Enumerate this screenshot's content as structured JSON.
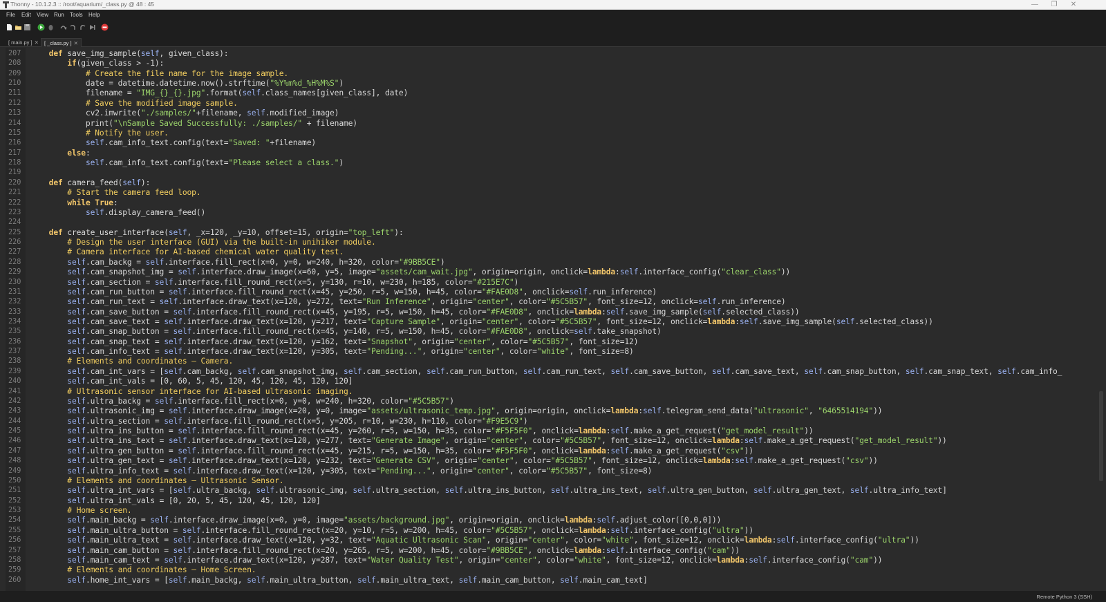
{
  "window": {
    "title": "Thonny  -  10.1.2.3 :: /root/aquarium/_class.py  @  48 : 45",
    "controls": {
      "minimize": "—",
      "maximize": "❐",
      "close": "✕"
    }
  },
  "menubar": {
    "items": [
      "File",
      "Edit",
      "View",
      "Run",
      "Tools",
      "Help"
    ]
  },
  "toolbar": {
    "buttons": [
      "new-file-icon",
      "open-folder-icon",
      "save-icon",
      "run-icon",
      "debug-icon",
      "step-over-icon",
      "step-into-icon",
      "step-out-icon",
      "resume-icon",
      "stop-icon"
    ]
  },
  "tabs": [
    {
      "label": "[ main.py ]",
      "close": "✕",
      "active": false
    },
    {
      "label": "[ _class.py ]",
      "close": "✕",
      "active": true
    }
  ],
  "editor": {
    "line_numbers": [
      "207",
      "208",
      "209",
      "210",
      "211",
      "212",
      "213",
      "214",
      "215",
      "216",
      "217",
      "218",
      "219",
      "220",
      "221",
      "222",
      "223",
      "224",
      "225",
      "226",
      "227",
      "228",
      "229",
      "230",
      "231",
      "232",
      "233",
      "234",
      "235",
      "236",
      "237",
      "238",
      "239",
      "240",
      "241",
      "242",
      "243",
      "244",
      "245",
      "246",
      "247",
      "248",
      "249",
      "250",
      "251",
      "252",
      "253",
      "254",
      "255",
      "256",
      "257",
      "258",
      "259",
      "260"
    ],
    "lines": [
      "    def save_img_sample(self, given_class):",
      "        if(given_class > -1):",
      "            # Create the file name for the image sample.",
      "            date = datetime.datetime.now().strftime(\"%Y%m%d_%H%M%S\")",
      "            filename = \"IMG_{}_{}.jpg\".format(self.class_names[given_class], date)",
      "            # Save the modified image sample.",
      "            cv2.imwrite(\"./samples/\"+filename, self.modified_image)",
      "            print(\"\\nSample Saved Successfully: ./samples/\" + filename)",
      "            # Notify the user.",
      "            self.cam_info_text.config(text=\"Saved: \"+filename)",
      "        else:",
      "            self.cam_info_text.config(text=\"Please select a class.\")",
      "",
      "    def camera_feed(self):",
      "        # Start the camera feed loop.",
      "        while True:",
      "            self.display_camera_feed()",
      "",
      "    def create_user_interface(self, _x=120, _y=10, offset=15, origin=\"top_left\"):",
      "        # Design the user interface (GUI) via the built-in unihiker module.",
      "        # Camera interface for AI-based chemical water quality test.",
      "        self.cam_backg = self.interface.fill_rect(x=0, y=0, w=240, h=320, color=\"#9BB5CE\")",
      "        self.cam_snapshot_img = self.interface.draw_image(x=60, y=5, image=\"assets/cam_wait.jpg\", origin=origin, onclick=lambda:self.interface_config(\"clear_class\"))",
      "        self.cam_section = self.interface.fill_round_rect(x=5, y=130, r=10, w=230, h=185, color=\"#215E7C\")",
      "        self.cam_run_button = self.interface.fill_round_rect(x=45, y=250, r=5, w=150, h=45, color=\"#FAE0D8\", onclick=self.run_inference)",
      "        self.cam_run_text = self.interface.draw_text(x=120, y=272, text=\"Run Inference\", origin=\"center\", color=\"#5C5B57\", font_size=12, onclick=self.run_inference)",
      "        self.cam_save_button = self.interface.fill_round_rect(x=45, y=195, r=5, w=150, h=45, color=\"#FAE0D8\", onclick=lambda:self.save_img_sample(self.selected_class))",
      "        self.cam_save_text = self.interface.draw_text(x=120, y=217, text=\"Capture Sample\", origin=\"center\", color=\"#5C5B57\", font_size=12, onclick=lambda:self.save_img_sample(self.selected_class))",
      "        self.cam_snap_button = self.interface.fill_round_rect(x=45, y=140, r=5, w=150, h=45, color=\"#FAE0D8\", onclick=self.take_snapshot)",
      "        self.cam_snap_text = self.interface.draw_text(x=120, y=162, text=\"Snapshot\", origin=\"center\", color=\"#5C5B57\", font_size=12)",
      "        self.cam_info_text = self.interface.draw_text(x=120, y=305, text=\"Pending...\", origin=\"center\", color=\"white\", font_size=8)",
      "        # Elements and coordinates — Camera.",
      "        self.cam_int_vars = [self.cam_backg, self.cam_snapshot_img, self.cam_section, self.cam_run_button, self.cam_run_text, self.cam_save_button, self.cam_save_text, self.cam_snap_button, self.cam_snap_text, self.cam_info_",
      "        self.cam_int_vals = [0, 60, 5, 45, 120, 45, 120, 45, 120, 120]",
      "        # Ultrasonic sensor interface for AI-based ultrasonic imaging.",
      "        self.ultra_backg = self.interface.fill_rect(x=0, y=0, w=240, h=320, color=\"#5C5B57\")",
      "        self.ultrasonic_img = self.interface.draw_image(x=20, y=0, image=\"assets/ultrasonic_temp.jpg\", origin=origin, onclick=lambda:self.telegram_send_data(\"ultrasonic\", \"6465514194\"))",
      "        self.ultra_section = self.interface.fill_round_rect(x=5, y=205, r=10, w=230, h=110, color=\"#F9E5C9\")",
      "        self.ultra_ins_button = self.interface.fill_round_rect(x=45, y=260, r=5, w=150, h=35, color=\"#F5F5F0\", onclick=lambda:self.make_a_get_request(\"get_model_result\"))",
      "        self.ultra_ins_text = self.interface.draw_text(x=120, y=277, text=\"Generate Image\", origin=\"center\", color=\"#5C5B57\", font_size=12, onclick=lambda:self.make_a_get_request(\"get_model_result\"))",
      "        self.ultra_gen_button = self.interface.fill_round_rect(x=45, y=215, r=5, w=150, h=35, color=\"#F5F5F0\", onclick=lambda:self.make_a_get_request(\"csv\"))",
      "        self.ultra_gen_text = self.interface.draw_text(x=120, y=232, text=\"Generate CSV\", origin=\"center\", color=\"#5C5B57\", font_size=12, onclick=lambda:self.make_a_get_request(\"csv\"))",
      "        self.ultra_info_text = self.interface.draw_text(x=120, y=305, text=\"Pending...\", origin=\"center\", color=\"#5C5B57\", font_size=8)",
      "        # Elements and coordinates — Ultrasonic Sensor.",
      "        self.ultra_int_vars = [self.ultra_backg, self.ultrasonic_img, self.ultra_section, self.ultra_ins_button, self.ultra_ins_text, self.ultra_gen_button, self.ultra_gen_text, self.ultra_info_text]",
      "        self.ultra_int_vals = [0, 20, 5, 45, 120, 45, 120, 120]",
      "        # Home screen.",
      "        self.main_backg = self.interface.draw_image(x=0, y=0, image=\"assets/background.jpg\", origin=origin, onclick=lambda:self.adjust_color([0,0,0]))",
      "        self.main_ultra_button = self.interface.fill_round_rect(x=20, y=10, r=5, w=200, h=45, color=\"#5C5B57\", onclick=lambda:self.interface_config(\"ultra\"))",
      "        self.main_ultra_text = self.interface.draw_text(x=120, y=32, text=\"Aquatic Ultrasonic Scan\", origin=\"center\", color=\"white\", font_size=12, onclick=lambda:self.interface_config(\"ultra\"))",
      "        self.main_cam_button = self.interface.fill_round_rect(x=20, y=265, r=5, w=200, h=45, color=\"#9BB5CE\", onclick=lambda:self.interface_config(\"cam\"))",
      "        self.main_cam_text = self.interface.draw_text(x=120, y=287, text=\"Water Quality Test\", origin=\"center\", color=\"white\", font_size=12, onclick=lambda:self.interface_config(\"cam\"))",
      "        # Elements and coordinates — Home Screen.",
      "        self.home_int_vars = [self.main_backg, self.main_ultra_button, self.main_ultra_text, self.main_cam_button, self.main_cam_text]"
    ]
  },
  "statusbar": {
    "text": "Remote Python 3 (SSH)"
  },
  "colors": {
    "background": "#2b2b2b",
    "keyword": "#f2c66a",
    "self": "#9ab1f0",
    "string": "#9bd36b",
    "comment": "#f1cd5f"
  }
}
